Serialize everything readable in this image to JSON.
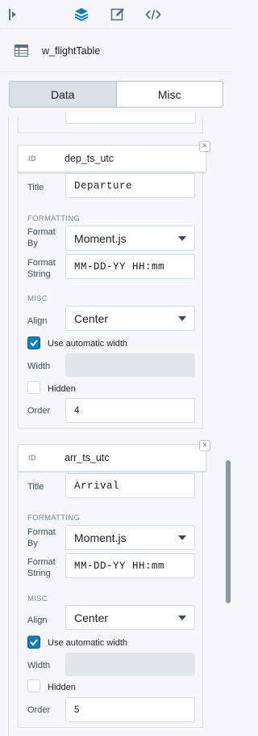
{
  "toolbar": {
    "icons": [
      "collapse-panel-icon",
      "layers-icon",
      "edit-icon",
      "code-icon"
    ],
    "active_color": "#137cbd"
  },
  "widget": {
    "name": "w_flightTable",
    "icon": "table-icon"
  },
  "tabs": [
    {
      "label": "Data",
      "active": true
    },
    {
      "label": "Misc",
      "active": false
    }
  ],
  "columns": [
    {
      "id_tag": "ID",
      "id": "dep_ts_utc",
      "title_label": "Title",
      "title": "Departure",
      "formatting_section": "FORMATTING",
      "format_by_label": "Format By",
      "format_by": "Moment.js",
      "format_string_label": "Format String",
      "format_string": "MM-DD-YY HH:mm",
      "misc_section": "MISC",
      "align_label": "Align",
      "align": "Center",
      "auto_width_label": "Use automatic width",
      "auto_width_checked": true,
      "width_label": "Width",
      "hidden_label": "Hidden",
      "hidden_checked": false,
      "order_label": "Order",
      "order": "4"
    },
    {
      "id_tag": "ID",
      "id": "arr_ts_utc",
      "title_label": "Title",
      "title": "Arrival",
      "formatting_section": "FORMATTING",
      "format_by_label": "Format By",
      "format_by": "Moment.js",
      "format_string_label": "Format String",
      "format_string": "MM-DD-YY HH:mm",
      "misc_section": "MISC",
      "align_label": "Align",
      "align": "Center",
      "auto_width_label": "Use automatic width",
      "auto_width_checked": true,
      "width_label": "Width",
      "hidden_label": "Hidden",
      "hidden_checked": false,
      "order_label": "Order",
      "order": "5"
    }
  ],
  "close_glyph": "×"
}
